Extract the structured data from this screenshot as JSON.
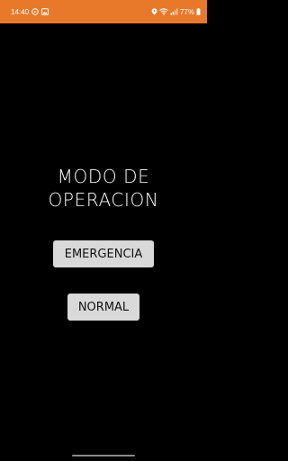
{
  "status_bar": {
    "time": "14:40",
    "battery": "77%",
    "background_color": "#e8792a",
    "left_icons": [
      "circle-p-icon",
      "image-icon"
    ],
    "right_icons": [
      "location-icon",
      "wifi-icon",
      "signal-icon",
      "battery-icon"
    ]
  },
  "screen": {
    "title_line1": "MODO DE",
    "title_line2": "OPERACION",
    "background_color": "#000000"
  },
  "buttons": {
    "emergencia_label": "EMERGENCIA",
    "normal_label": "NORMAL",
    "background_color": "#d9d9d9"
  }
}
